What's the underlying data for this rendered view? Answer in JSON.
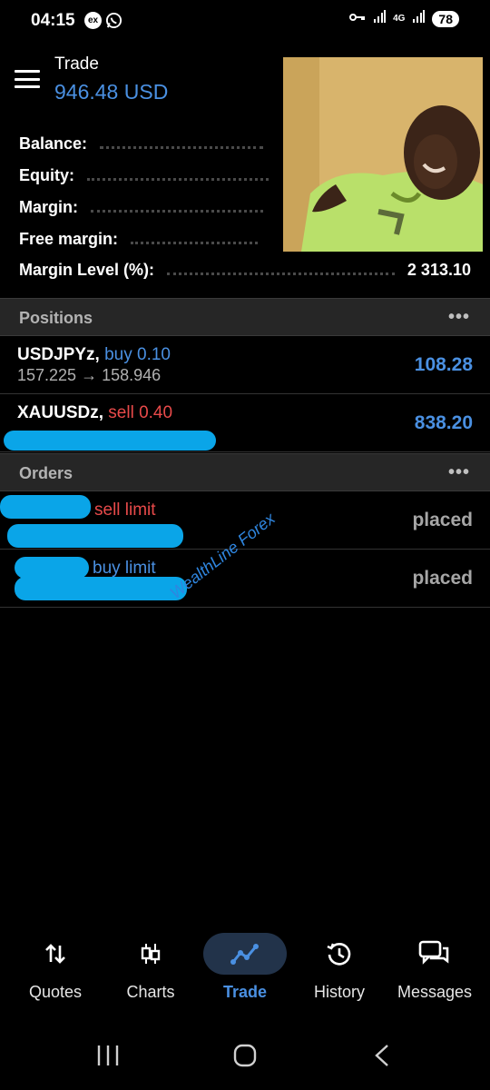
{
  "status_bar": {
    "time": "04:15",
    "notif_icons": [
      "exness-icon",
      "whatsapp-icon"
    ],
    "exness_label": "ex",
    "network": "4G",
    "battery": "78"
  },
  "header": {
    "title": "Trade",
    "value": "946.48 USD"
  },
  "summary": {
    "rows": [
      {
        "label": "Balance:",
        "value": ""
      },
      {
        "label": "Equity:",
        "value": ""
      },
      {
        "label": "Margin:",
        "value": ""
      },
      {
        "label": "Free margin:",
        "value": ""
      },
      {
        "label": "Margin Level (%):",
        "value": "2 313.10"
      }
    ]
  },
  "positions": {
    "title": "Positions",
    "more": "•••",
    "items": [
      {
        "symbol": "USDJPYz,",
        "side": "buy 0.10",
        "side_type": "buy",
        "prices": "157.225 → 158.946",
        "profit": "108.28"
      },
      {
        "symbol": "XAUUSDz,",
        "side": "sell 0.40",
        "side_type": "sell",
        "prices": "",
        "profit": "838.20"
      }
    ]
  },
  "orders": {
    "title": "Orders",
    "more": "•••",
    "items": [
      {
        "side": "sell limit",
        "side_type": "sell",
        "status": "placed"
      },
      {
        "side": "buy limit",
        "side_type": "buy",
        "status": "placed"
      }
    ]
  },
  "watermark": "WealthLine Forex",
  "bottom_nav": {
    "items": [
      {
        "label": "Quotes",
        "icon": "quotes-icon"
      },
      {
        "label": "Charts",
        "icon": "charts-icon"
      },
      {
        "label": "Trade",
        "icon": "trade-icon",
        "active": true
      },
      {
        "label": "History",
        "icon": "history-icon"
      },
      {
        "label": "Messages",
        "icon": "messages-icon"
      }
    ]
  },
  "colors": {
    "accent": "#4a90e2",
    "sell": "#e84a4a",
    "background": "#000000",
    "section_bar": "#262626",
    "redaction": "#0aa5e8"
  }
}
